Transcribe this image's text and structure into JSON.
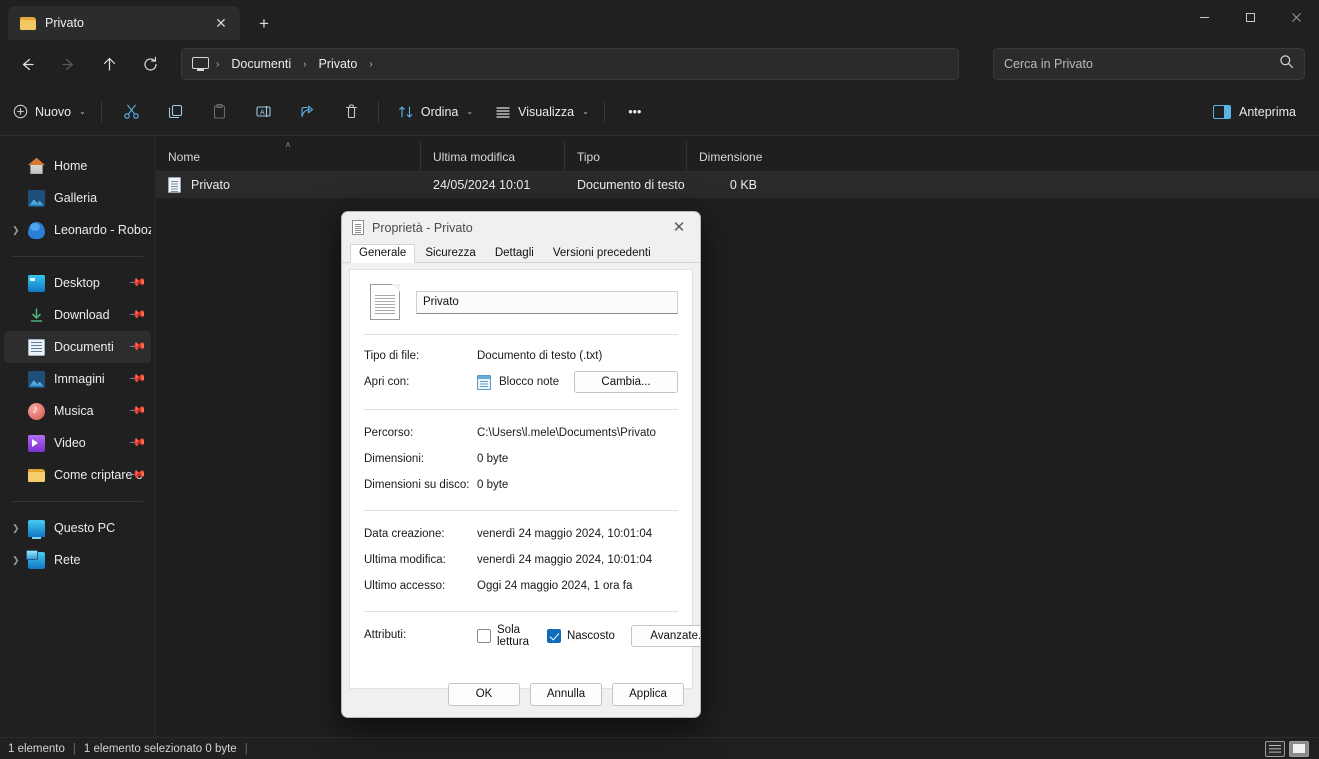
{
  "window": {
    "tab": {
      "title": "Privato",
      "icon": "folder-icon",
      "close": "✕"
    },
    "new_tab": "+",
    "controls": {
      "minimize": "minimize-icon",
      "maximize": "maximize-icon",
      "close": "close-icon"
    }
  },
  "nav": {
    "back": "back-arrow-icon",
    "forward": "forward-arrow-icon",
    "up": "up-arrow-icon",
    "refresh": "refresh-icon",
    "breadcrumbs": [
      "Documenti",
      "Privato"
    ],
    "separator": "›"
  },
  "search": {
    "placeholder": "Cerca in Privato",
    "icon": "search-icon"
  },
  "toolbar": {
    "new_label": "Nuovo",
    "cut_label": "Taglia",
    "copy_label": "Copia",
    "paste_label": "Incolla",
    "rename_label": "Rinomina",
    "share_label": "Condividi",
    "delete_label": "Elimina",
    "sort_label": "Ordina",
    "view_label": "Visualizza",
    "more_label": "•••",
    "preview_label": "Anteprima",
    "chevron": "⌄"
  },
  "sidebar": {
    "groups": [
      {
        "items": [
          {
            "label": "Home",
            "icon": "home-icon",
            "expandable": false,
            "pinned": false,
            "selected": false
          },
          {
            "label": "Galleria",
            "icon": "gallery-icon",
            "expandable": false,
            "pinned": false,
            "selected": false
          },
          {
            "label": "Leonardo - Roboze",
            "icon": "onedrive-cloud-icon",
            "expandable": true,
            "pinned": false,
            "selected": false
          }
        ]
      },
      {
        "items": [
          {
            "label": "Desktop",
            "icon": "desktop-icon",
            "expandable": false,
            "pinned": true,
            "selected": false
          },
          {
            "label": "Download",
            "icon": "download-icon",
            "expandable": false,
            "pinned": true,
            "selected": false
          },
          {
            "label": "Documenti",
            "icon": "documents-icon",
            "expandable": false,
            "pinned": true,
            "selected": true
          },
          {
            "label": "Immagini",
            "icon": "pictures-icon",
            "expandable": false,
            "pinned": true,
            "selected": false
          },
          {
            "label": "Musica",
            "icon": "music-icon",
            "expandable": false,
            "pinned": true,
            "selected": false
          },
          {
            "label": "Video",
            "icon": "video-icon",
            "expandable": false,
            "pinned": true,
            "selected": false
          },
          {
            "label": "Come criptare c",
            "icon": "folder-icon",
            "expandable": false,
            "pinned": true,
            "selected": false
          }
        ]
      },
      {
        "items": [
          {
            "label": "Questo PC",
            "icon": "this-pc-icon",
            "expandable": true,
            "pinned": false,
            "selected": false
          },
          {
            "label": "Rete",
            "icon": "network-icon",
            "expandable": true,
            "pinned": false,
            "selected": false
          }
        ]
      }
    ]
  },
  "filelist": {
    "columns": [
      {
        "label": "Nome",
        "sorted": true,
        "sort_dir": "˄"
      },
      {
        "label": "Ultima modifica",
        "sorted": false
      },
      {
        "label": "Tipo",
        "sorted": false
      },
      {
        "label": "Dimensione",
        "sorted": false
      }
    ],
    "rows": [
      {
        "name": "Privato",
        "icon": "text-file-icon",
        "modified": "24/05/2024 10:01",
        "type": "Documento di testo",
        "size": "0 KB",
        "selected": true
      }
    ]
  },
  "statusbar": {
    "count": "1 elemento",
    "divider": "|",
    "selection": "1 elemento selezionato  0 byte",
    "trailing_divider": "|",
    "view_details": "details-view-icon",
    "view_icons": "large-icons-view-icon"
  },
  "dialog": {
    "title": "Proprietà - Privato",
    "icon": "text-file-icon",
    "close": "✕",
    "tabs": [
      {
        "label": "Generale",
        "active": true
      },
      {
        "label": "Sicurezza",
        "active": false
      },
      {
        "label": "Dettagli",
        "active": false
      },
      {
        "label": "Versioni precedenti",
        "active": false
      }
    ],
    "filename": "Privato",
    "fields": {
      "tipo_key": "Tipo di file:",
      "tipo_val": "Documento di testo (.txt)",
      "apri_key": "Apri con:",
      "apri_val": "Blocco note",
      "cambia_btn": "Cambia...",
      "percorso_key": "Percorso:",
      "percorso_val": "C:\\Users\\l.mele\\Documents\\Privato",
      "dimensioni_key": "Dimensioni:",
      "dimensioni_val": "0 byte",
      "disco_key": "Dimensioni su disco:",
      "disco_val": "0 byte",
      "creazione_key": "Data creazione:",
      "creazione_val": "venerdì 24 maggio 2024, 10:01:04",
      "modifica_key": "Ultima modifica:",
      "modifica_val": "venerdì 24 maggio 2024, 10:01:04",
      "accesso_key": "Ultimo accesso:",
      "accesso_val": "Oggi 24 maggio 2024, 1 ora fa",
      "attributi_key": "Attributi:",
      "sola_lettura": "Sola lettura",
      "sola_lettura_checked": false,
      "nascosto": "Nascosto",
      "nascosto_checked": true,
      "avanzate_btn": "Avanzate..."
    },
    "buttons": {
      "ok": "OK",
      "cancel": "Annulla",
      "apply": "Applica"
    }
  },
  "colors": {
    "accent": "#0f6cbd",
    "toolbar_icon": "#5ab4e8",
    "selection": "#2a2a2a"
  }
}
